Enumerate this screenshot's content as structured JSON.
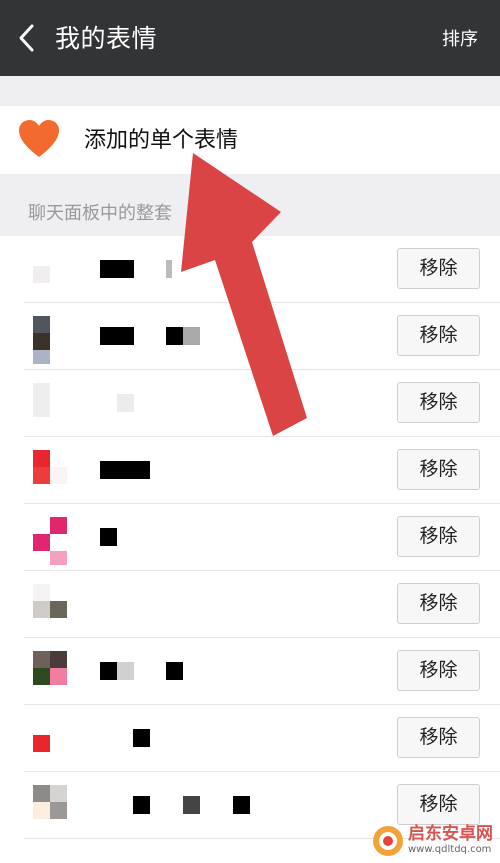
{
  "header": {
    "back_icon": "chevron-left-icon",
    "title": "我的表情",
    "sort_label": "排序"
  },
  "single": {
    "icon": "heart-icon",
    "label": "添加的单个表情"
  },
  "section": {
    "title": "聊天面板中的整套"
  },
  "packs": [
    {
      "remove_label": "移除"
    },
    {
      "remove_label": "移除"
    },
    {
      "remove_label": "移除"
    },
    {
      "remove_label": "移除"
    },
    {
      "remove_label": "移除"
    },
    {
      "remove_label": "移除"
    },
    {
      "remove_label": "移除"
    },
    {
      "remove_label": "移除"
    },
    {
      "remove_label": "移除"
    }
  ],
  "colors": {
    "topbar": "#333436",
    "heart": "#f26a2e",
    "arrow": "#d83a3a",
    "background": "#efeff2"
  },
  "watermark": {
    "name": "启东安卓网",
    "url": "www.qdltdq.com"
  }
}
